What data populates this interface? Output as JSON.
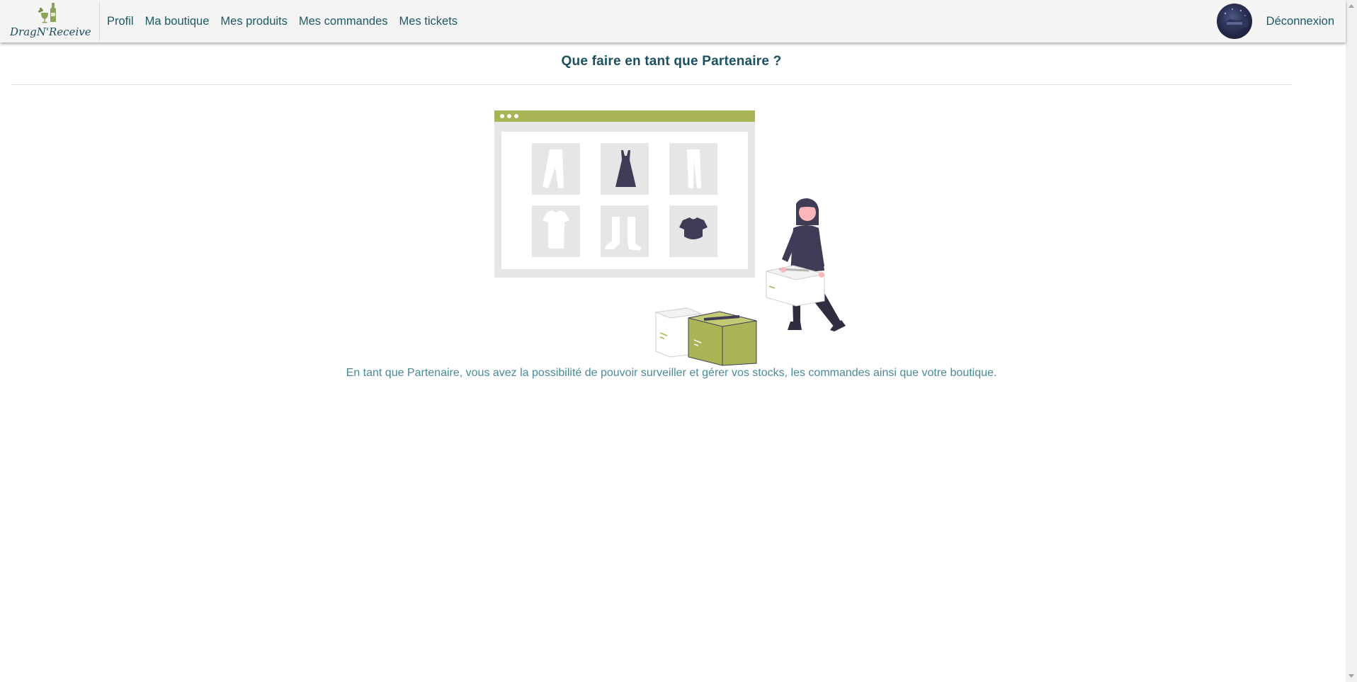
{
  "brand": {
    "name": "DragN'Receive"
  },
  "nav": {
    "items": [
      {
        "label": "Profil"
      },
      {
        "label": "Ma boutique"
      },
      {
        "label": "Mes produits"
      },
      {
        "label": "Mes commandes"
      },
      {
        "label": "Mes tickets"
      }
    ],
    "logout_label": "Déconnexion"
  },
  "main": {
    "title": "Que faire en tant que Partenaire ?",
    "description": "En tant que Partenaire, vous avez la possibilité de pouvoir surveiller et gérer vos stocks, les commandes ainsi que votre boutique."
  },
  "colors": {
    "accent_green": "#a8b456",
    "nav_text": "#1d5a66",
    "title_text": "#1b5060",
    "body_text": "#4a8a96",
    "dark_figure": "#3f3d56"
  },
  "icons": [
    "wine-bottle-logo-icon",
    "user-avatar",
    "scroll-up-arrow-icon",
    "scroll-down-arrow-icon"
  ]
}
